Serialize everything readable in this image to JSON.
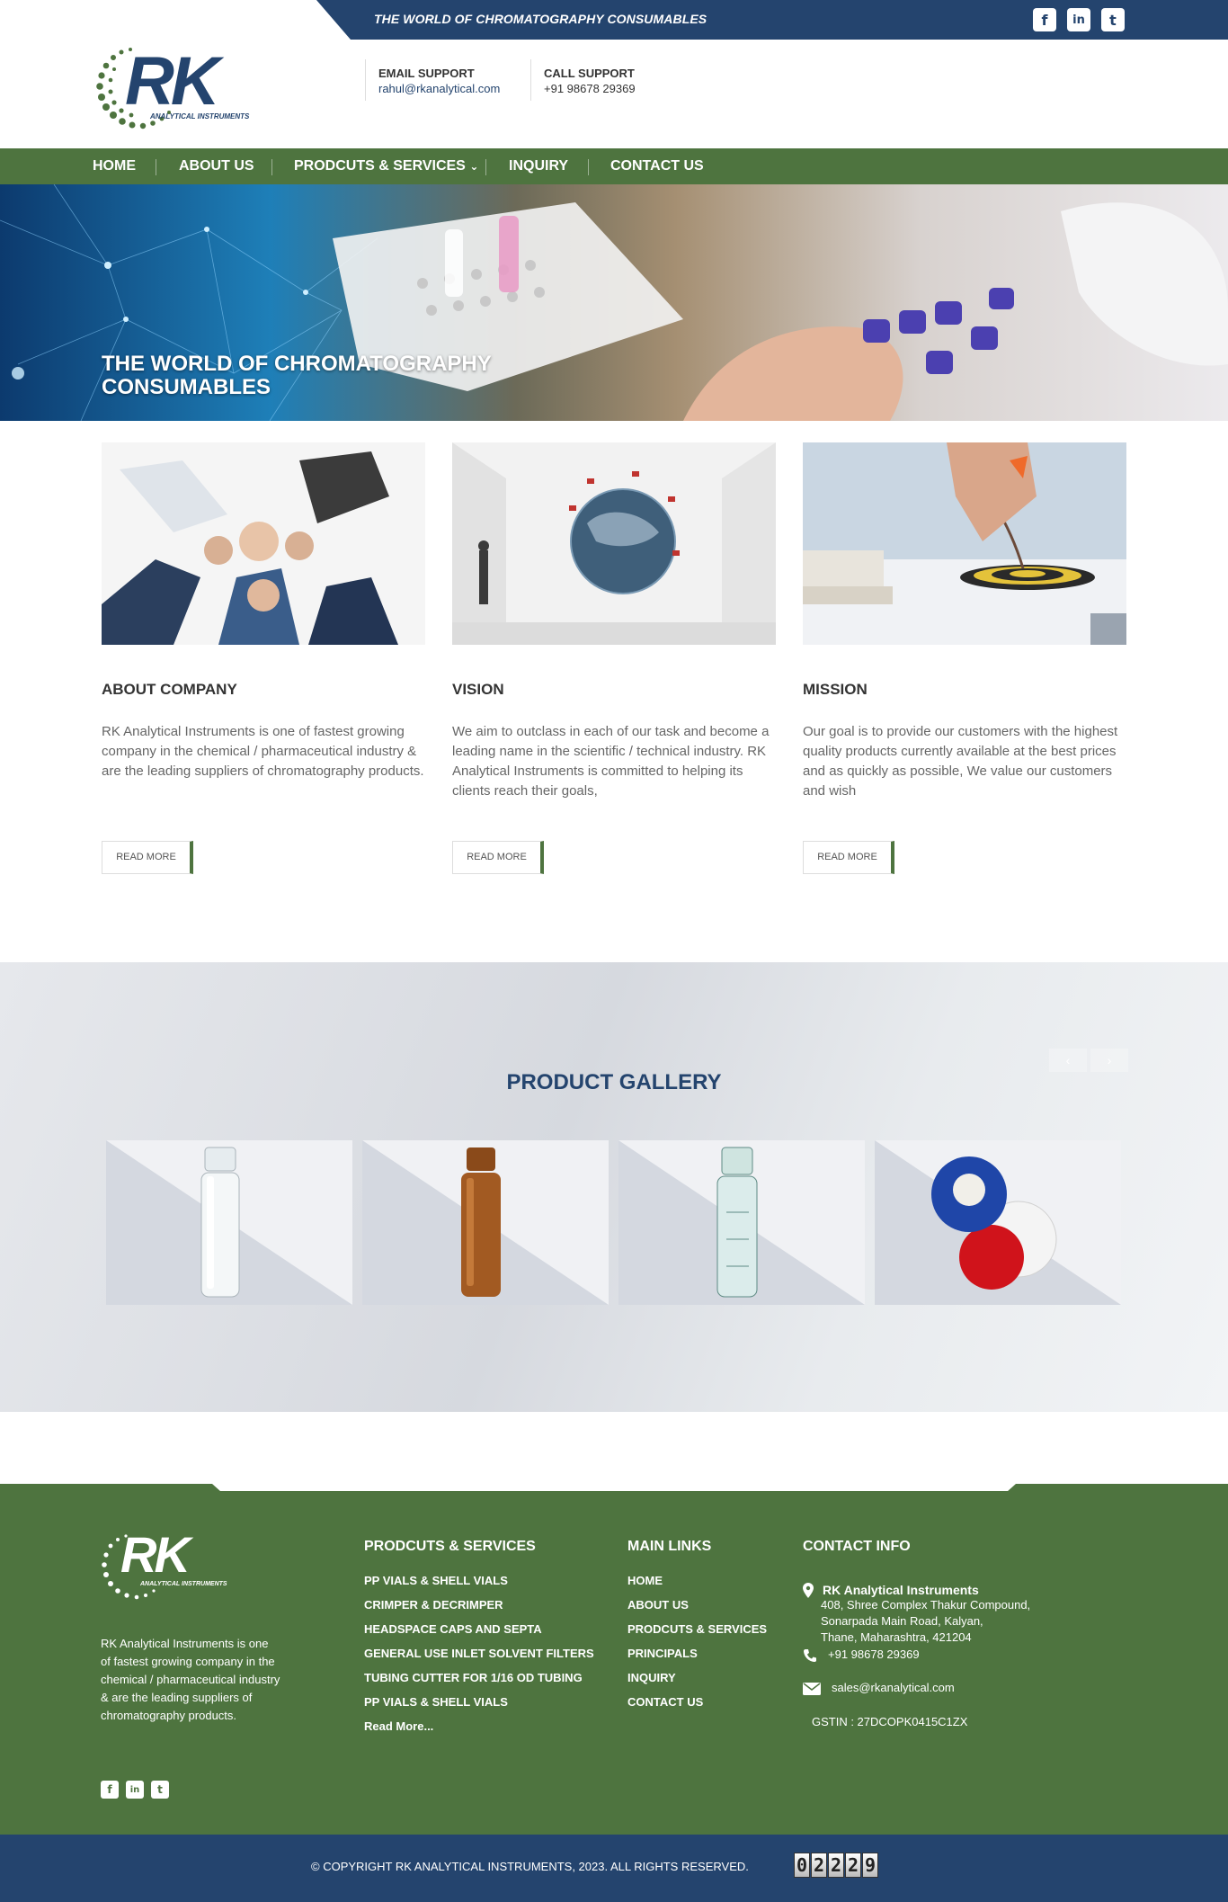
{
  "topbar": {
    "tagline": "THE WORLD OF CHROMATOGRAPHY CONSUMABLES",
    "social": [
      {
        "name": "facebook-icon",
        "glyph": "f"
      },
      {
        "name": "linkedin-icon",
        "glyph": "in"
      },
      {
        "name": "twitter-icon",
        "glyph": "t"
      }
    ]
  },
  "header": {
    "logo_text": "RK",
    "logo_subtext": "ANALYTICAL INSTRUMENTS",
    "email_label": "EMAIL SUPPORT",
    "email": "rahul@rkanalytical.com",
    "call_label": "CALL SUPPORT",
    "phone": "+91 98678 29369"
  },
  "nav": {
    "items": [
      "HOME",
      "ABOUT US",
      "PRODCUTS & SERVICES",
      "INQUIRY",
      "CONTACT US"
    ],
    "dropdown_glyph": "⌄"
  },
  "hero": {
    "title_line1": "THE WORLD OF CHROMATOGRAPHY",
    "title_line2": "CONSUMABLES"
  },
  "columns": [
    {
      "title": "ABOUT COMPANY",
      "text": "RK Analytical Instruments is one of fastest growing company in the chemical / pharmaceutical industry & are the leading suppliers of chromatography products.",
      "button": "READ MORE"
    },
    {
      "title": "VISION",
      "text": "We aim to outclass in each of our task and become a leading name in the scientific / technical industry. RK Analytical Instruments is committed to helping its clients reach their goals,",
      "button": "READ MORE"
    },
    {
      "title": "MISSION",
      "text": "Our goal is to provide our customers with the highest quality products currently available at the best prices and as quickly as possible, We value our customers and wish",
      "button": "READ MORE"
    }
  ],
  "gallery": {
    "title": "PRODUCT GALLERY",
    "prev": "‹",
    "next": "›"
  },
  "footer": {
    "about_text": "RK Analytical Instruments is one of fastest growing company in the chemical / pharmaceutical industry & are the leading suppliers of chromatography products.",
    "products_heading": "PRODCUTS & SERVICES",
    "products": [
      "PP VIALS & SHELL VIALS",
      "CRIMPER & DECRIMPER",
      "HEADSPACE CAPS AND SEPTA",
      "GENERAL USE INLET SOLVENT FILTERS",
      "TUBING CUTTER FOR 1/16 OD TUBING",
      "PP VIALS & SHELL VIALS",
      "Read More..."
    ],
    "links_heading": "MAIN LINKS",
    "links": [
      "HOME",
      "ABOUT US",
      "PRODCUTS & SERVICES",
      "PRINCIPALS",
      "INQUIRY",
      "CONTACT US"
    ],
    "contact_heading": "CONTACT INFO",
    "company": "RK Analytical Instruments",
    "address_lines": [
      "408, Shree Complex Thakur Compound,",
      "Sonarpada Main Road, Kalyan,",
      "Thane, Maharashtra, 421204"
    ],
    "phone": "+91 98678 29369",
    "email": "sales@rkanalytical.com",
    "gstin": "GSTIN : 27DCOPK0415C1ZX"
  },
  "copyright": {
    "text": "© COPYRIGHT RK ANALYTICAL INSTRUMENTS, 2023. ALL RIGHTS RESERVED.",
    "counter_digits": [
      "0",
      "2",
      "2",
      "2",
      "9"
    ]
  },
  "colors": {
    "navy": "#24446e",
    "green": "#4e743f"
  }
}
